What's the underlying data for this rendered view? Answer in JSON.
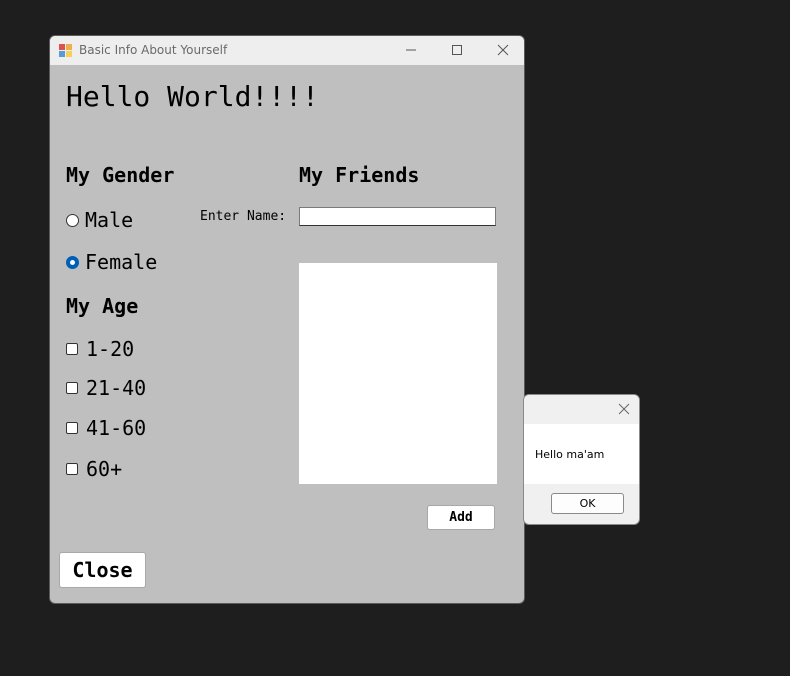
{
  "window": {
    "title": "Basic Info About Yourself",
    "heading": "Hello World!!!!"
  },
  "gender": {
    "title": "My Gender",
    "options": [
      {
        "label": "Male",
        "checked": false
      },
      {
        "label": "Female",
        "checked": true
      }
    ]
  },
  "age": {
    "title": "My Age",
    "options": [
      {
        "label": "1-20",
        "checked": false
      },
      {
        "label": "21-40",
        "checked": false
      },
      {
        "label": "41-60",
        "checked": false
      },
      {
        "label": "60+",
        "checked": false
      }
    ]
  },
  "friends": {
    "title": "My Friends",
    "enter_label": "Enter Name:",
    "input_value": "",
    "items": [],
    "add_label": "Add"
  },
  "close_label": "Close",
  "message_box": {
    "text": "Hello ma'am",
    "ok_label": "OK"
  },
  "colors": {
    "accent": "#005fb8",
    "window_bg": "#bfbfbf",
    "desktop_bg": "#1e1e1e"
  }
}
